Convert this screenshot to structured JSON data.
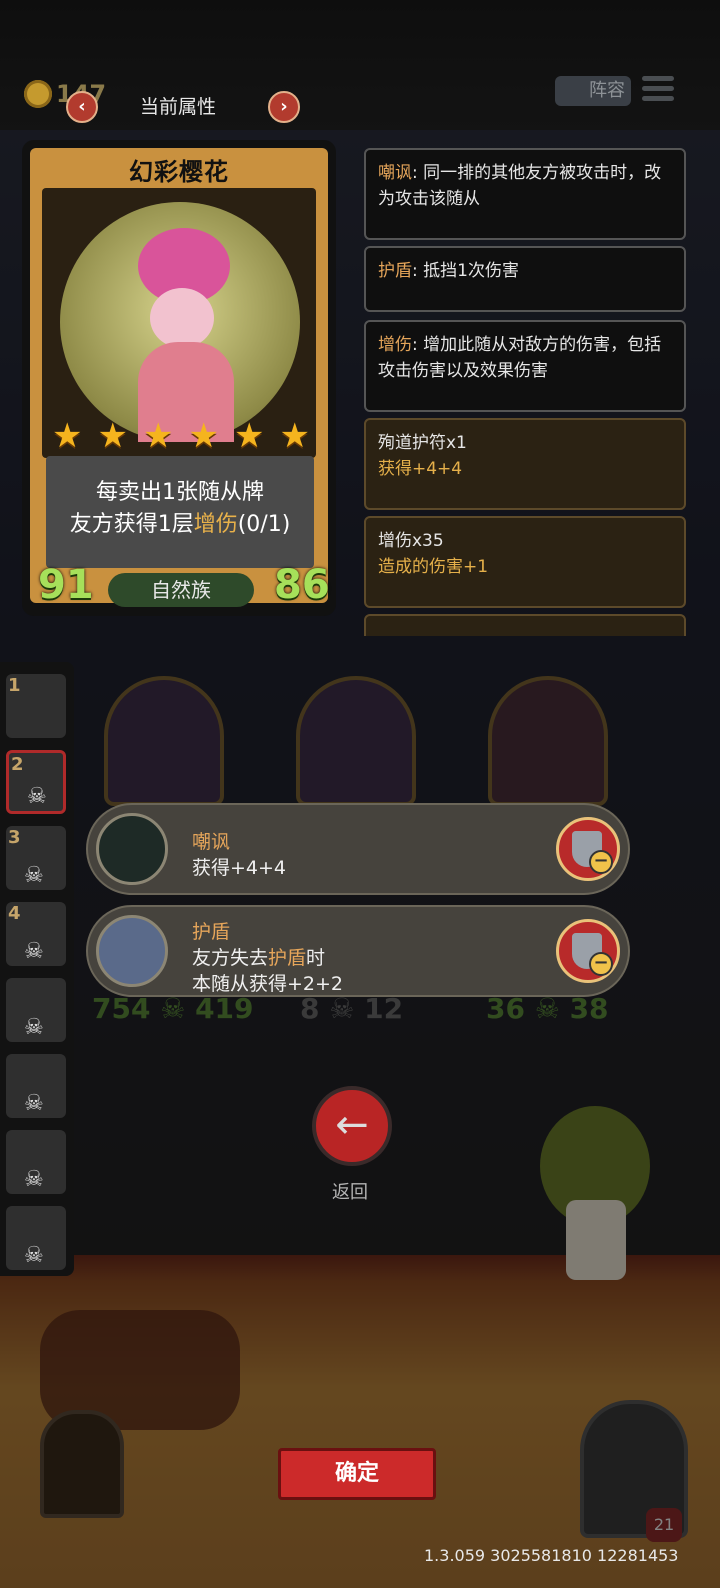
{
  "top_bar": {
    "coins": "147",
    "title": "当前属性",
    "prev_symbol": "‹",
    "next_symbol": "›",
    "team_label": "阵容"
  },
  "hero_card": {
    "name": "幻彩樱花",
    "star_count": 6,
    "ability_line1": "每卖出1张随从牌",
    "ability_line2_pre": "友方获得1层",
    "ability_line2_keyword": "增伤",
    "ability_line2_post": "(0/1)",
    "attack": "91",
    "health": "86",
    "tribe": "自然族"
  },
  "info_panels": [
    {
      "keyword": "嘲讽",
      "text": ": 同一排的其他友方被攻击时，改为攻击该随从"
    },
    {
      "keyword": "护盾",
      "text": ": 抵挡1次伤害"
    },
    {
      "keyword": "增伤",
      "text": ": 增加此随从对敌方的伤害，包括攻击伤害以及效果伤害"
    },
    {
      "title": "殉道护符x1",
      "sub": "获得+4+4"
    },
    {
      "title": "增伤x35",
      "sub": "造成的伤害+1"
    }
  ],
  "roster": {
    "slot_numbers": [
      "1",
      "2",
      "3",
      "4"
    ],
    "skull_icon": "skull-icon"
  },
  "board_stats": [
    {
      "atk": "754",
      "hp": "419"
    },
    {
      "atk": "8",
      "hp": "12"
    },
    {
      "atk": "36",
      "hp": "38"
    }
  ],
  "effects": [
    {
      "title": "嘲讽",
      "line1": "获得+4+4",
      "line2": ""
    },
    {
      "title": "护盾",
      "line1_pre": "友方失去",
      "line1_kw": "护盾",
      "line1_post": "时",
      "line2": "本随从获得+2+2"
    }
  ],
  "back_label": "返回",
  "confirm_label": "确定",
  "version": "1.3.059 3025581810 12281453",
  "player_level": "21",
  "colors": {
    "accent_red": "#cc2a2a",
    "keyword_orange": "#e5a55a",
    "stat_green": "#a6e05a",
    "card_gold": "#c9913f"
  }
}
